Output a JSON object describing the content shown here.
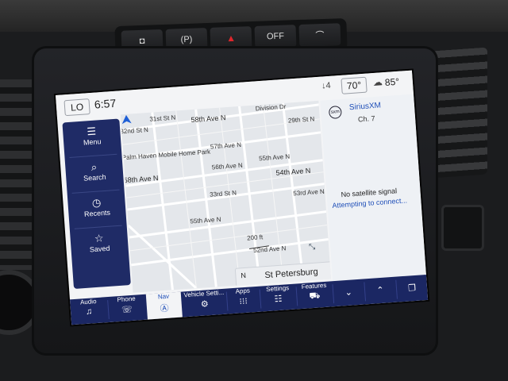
{
  "header_buttons": [
    {
      "icon": "parking-sensor-icon",
      "label": "◘"
    },
    {
      "icon": "parking-assist-icon",
      "label": "(P)"
    },
    {
      "icon": "hazard-icon",
      "label": "▲"
    },
    {
      "icon": "traction-off-icon",
      "label": "OFF"
    },
    {
      "icon": "camera-icon",
      "label": "⌒"
    }
  ],
  "status": {
    "lo_label": "LO",
    "clock": "6:57",
    "signal": "↓4",
    "temp_setting": "70°",
    "outside_temp": "85°"
  },
  "map": {
    "streets": [
      {
        "text": "31st St N"
      },
      {
        "text": "32nd St N"
      },
      {
        "text": "58th Ave N"
      },
      {
        "text": "Division Dr"
      },
      {
        "text": "29th St N"
      },
      {
        "text": "Palm Haven Mobile Home Park"
      },
      {
        "text": "57th Ave N"
      },
      {
        "text": "58th Ave N"
      },
      {
        "text": "56th Ave N"
      },
      {
        "text": "55th Ave N"
      },
      {
        "text": "54th Ave N"
      },
      {
        "text": "33rd St N"
      },
      {
        "text": "53rd Ave N"
      },
      {
        "text": "55th Ave N"
      },
      {
        "text": "52nd Ave N"
      }
    ],
    "scale": "200 ft",
    "compass": "N",
    "city": "St Petersburg"
  },
  "left_menu": [
    {
      "icon": "menu-icon",
      "label": "Menu"
    },
    {
      "icon": "search-icon",
      "label": "Search"
    },
    {
      "icon": "recents-icon",
      "label": "Recents"
    },
    {
      "icon": "saved-icon",
      "label": "Saved"
    }
  ],
  "audio": {
    "logo": "sxm",
    "station": "SiriusXM",
    "channel": "Ch. 7",
    "no_signal": "No satellite signal",
    "attempting": "Attempting to connect..."
  },
  "bottom_nav": [
    {
      "icon": "audio-icon",
      "label": "Audio"
    },
    {
      "icon": "phone-icon",
      "label": "Phone"
    },
    {
      "icon": "nav-icon",
      "label": "Nav",
      "active": true
    },
    {
      "icon": "vehicle-settings-icon",
      "label": "Vehicle Setti..."
    },
    {
      "icon": "apps-icon",
      "label": "Apps"
    },
    {
      "icon": "settings-icon",
      "label": "Settings"
    },
    {
      "icon": "features-icon",
      "label": "Features"
    },
    {
      "icon": "chevron-down-icon",
      "label": ""
    },
    {
      "icon": "chevron-up-icon",
      "label": ""
    },
    {
      "icon": "windows-icon",
      "label": ""
    }
  ]
}
